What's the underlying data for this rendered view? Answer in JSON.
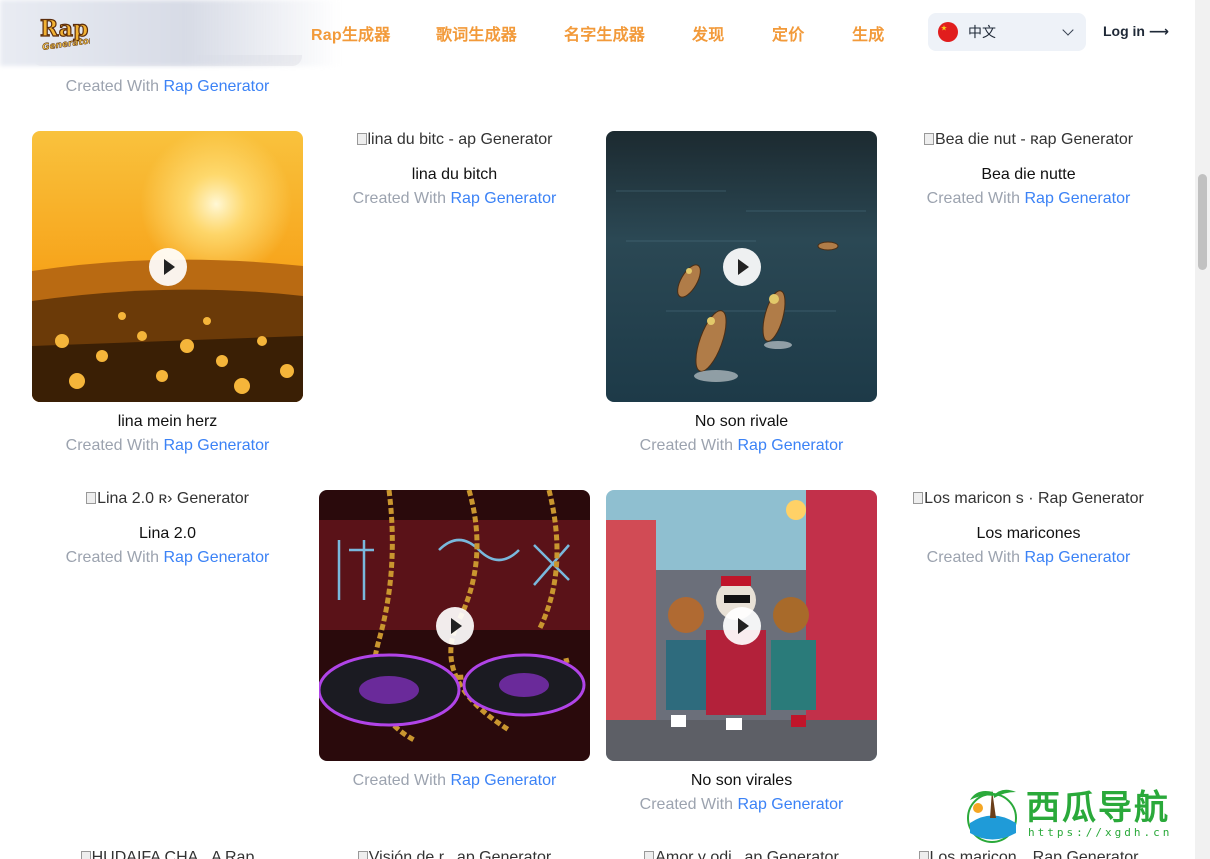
{
  "header": {
    "logo_text": "Rap Generator",
    "nav": [
      "Rap生成器",
      "歌词生成器",
      "名字生成器",
      "发现",
      "定价",
      "生成"
    ],
    "language": "中文",
    "login": "Log in"
  },
  "top_card": {
    "credit_prefix": "Created With",
    "credit_link": "Rap Generator"
  },
  "cards": [
    {
      "alt": "lina mein herz",
      "title": "lina mein herz",
      "credit_prefix": "Created With",
      "credit_link": "Rap Generator",
      "image": "sunset-flower-field"
    },
    {
      "alt": "lina du bitc - ap Generator",
      "title": "lina du bitch",
      "credit_prefix": "Created With",
      "credit_link": "Rap Generator",
      "image": "broken"
    },
    {
      "alt": "No son rivale",
      "title": "No son rivale",
      "credit_prefix": "Created With",
      "credit_link": "Rap Generator",
      "image": "kayaks-on-water"
    },
    {
      "alt": "Bea die nut - ʀap Generator",
      "title": "Bea die nutte",
      "credit_prefix": "Created With",
      "credit_link": "Rap Generator",
      "image": "broken"
    },
    {
      "alt": "Lina 2.0 ʀ› Generator",
      "title": "Lina 2.0",
      "credit_prefix": "Created With",
      "credit_link": "Rap Generator",
      "image": "broken"
    },
    {
      "alt": "",
      "title": "",
      "credit_prefix": "Created With",
      "credit_link": "Rap Generator",
      "image": "gold-chains-turntables"
    },
    {
      "alt": "No son virales",
      "title": "No son virales",
      "credit_prefix": "Created With",
      "credit_link": "Rap Generator",
      "image": "cartoon-dogs-street"
    },
    {
      "alt": "Los maricon s · Rap Generator",
      "title": "Los maricones",
      "credit_prefix": "Created With",
      "credit_link": "Rap Generator",
      "image": "broken"
    }
  ],
  "bottom_row_alts": [
    "HUDAIFA CHA    A Rap",
    "Visión de r    ap Generator",
    "Amor y odi    ap Generator",
    "Los maricon     Rap Generator"
  ],
  "watermark": {
    "text": "西瓜导航",
    "url": "https://xgdh.cn"
  },
  "colors": {
    "nav": "#f29a3a",
    "link": "#3b82f6",
    "muted": "#9ca3af"
  }
}
